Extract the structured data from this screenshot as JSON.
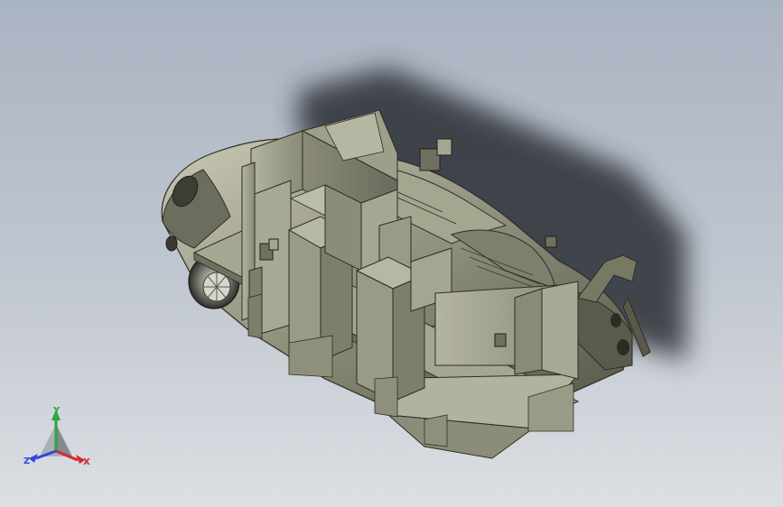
{
  "window": {
    "background_top": "#aab3c2",
    "background_bottom": "#dcdfe3"
  },
  "model": {
    "kind": "3D CAD model - car body with internal partition panels",
    "body_color": "#8e8f7a",
    "panel_color": "#a3a48f",
    "shadow_color": "#2b2f36"
  },
  "triad": {
    "x_label": "X",
    "y_label": "Y",
    "z_label": "Z",
    "x_color": "#d8262c",
    "y_color": "#2aa63a",
    "z_color": "#2f48d8"
  }
}
